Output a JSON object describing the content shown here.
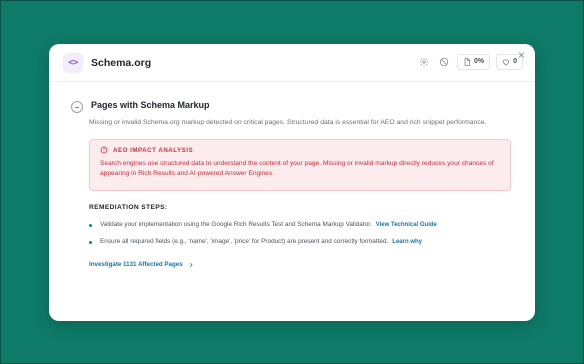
{
  "header": {
    "title": "Schema.org",
    "badge_symbol": "<>",
    "percent_label": "0%",
    "likes_label": "0"
  },
  "section": {
    "title": "Pages with Schema Markup",
    "description": "Missing or invalid Schema.org markup detected on critical pages. Structured data is essential for AEO and rich snippet performance."
  },
  "aeo": {
    "title": "AEO IMPACT ANALYSIS",
    "text": "Search engines use structured data to understand the content of your page. Missing or invalid markup directly reduces your chances of appearing in Rich Results and AI-powered Answer Engines."
  },
  "remediation": {
    "heading": "REMEDIATION STEPS:",
    "steps": [
      {
        "text": "Validate your implementation using the Google Rich Results Test and Schema Markup Validator.",
        "link": "View Technical Guide"
      },
      {
        "text": "Ensure all required fields (e.g., 'name', 'image', 'price' for Product) are present and correctly formatted.",
        "link": "Learn why"
      }
    ]
  },
  "investigate_label": "Investigate 1131 Affected Pages",
  "colors": {
    "background": "#0e7a68",
    "accent_purple": "#8a4fd8",
    "alert_red": "#c8333c",
    "link_blue": "#1976a8",
    "bullet_green": "#0e8a74"
  },
  "icons": {
    "close": "close-icon",
    "settings": "gear-icon",
    "ignore": "ban-icon",
    "document": "document-icon",
    "like": "heart-icon",
    "alert": "alert-circle-icon",
    "chevron": "chevron-right-icon",
    "collapse": "minus-circle-icon"
  }
}
